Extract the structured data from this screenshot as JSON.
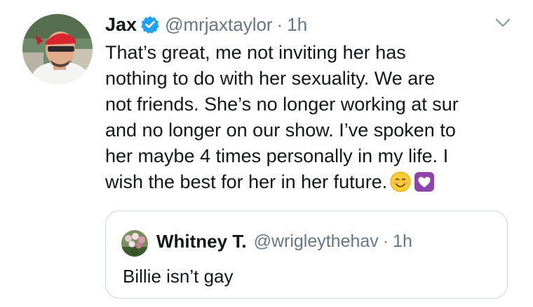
{
  "tweet": {
    "author": {
      "display_name": "Jax",
      "handle": "@mrjaxtaylor",
      "verified": true,
      "avatar_icon": "user-avatar-icon"
    },
    "separator": "·",
    "time": "1h",
    "text_lines": [
      "That’s great, me not inviting her has",
      "nothing to do with her sexuality. We are",
      "not friends. She’s no longer working at sur",
      "and no longer on our show. I’ve spoken to",
      "her maybe 4 times personally in my life. I",
      "wish the best for her in her future."
    ],
    "emojis": [
      "smiling-face-emoji",
      "purple-heart-emoji"
    ],
    "more_icon": "chevron-down-icon"
  },
  "quoted_tweet": {
    "display_name": "Whitney T.",
    "handle": "@wrigleythehav",
    "separator": "·",
    "time": "1h",
    "text": "Billie isn’t gay",
    "avatar_icon": "flowers-avatar-icon"
  },
  "colors": {
    "text_primary": "#14171a",
    "text_secondary": "#657786",
    "verified_blue": "#1da1f2",
    "border": "#ccd6dd",
    "heart_purple": "#8e44ad",
    "smile_yellow": "#ffcc33"
  }
}
